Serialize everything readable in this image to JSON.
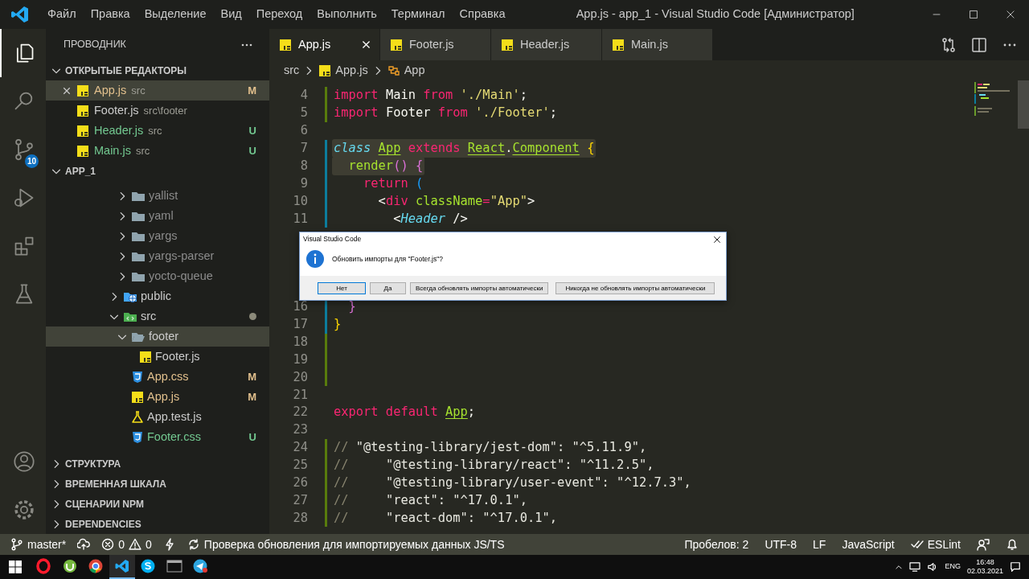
{
  "title_bar": {
    "menu": [
      "Файл",
      "Правка",
      "Выделение",
      "Вид",
      "Переход",
      "Выполнить",
      "Терминал",
      "Справка"
    ],
    "title": "App.js - app_1 - Visual Studio Code [Администратор]"
  },
  "activity_bar": [
    {
      "kind": "explorer",
      "selected": true
    },
    {
      "kind": "search",
      "selected": false
    },
    {
      "kind": "source-control",
      "selected": false,
      "badge": "10"
    },
    {
      "kind": "run",
      "selected": false
    },
    {
      "kind": "extensions",
      "selected": false
    },
    {
      "kind": "testing",
      "selected": false
    }
  ],
  "activity_bar_bottom": [
    {
      "kind": "account"
    },
    {
      "kind": "settings"
    }
  ],
  "sidebar": {
    "title": "ПРОВОДНИК",
    "open_editors": {
      "title": "ОТКРЫТЫЕ РЕДАКТОРЫ",
      "expanded": true,
      "items": [
        {
          "name": "App.js",
          "description": "src",
          "kind": "js",
          "modified": true,
          "badge": "M",
          "selected": true
        },
        {
          "name": "Footer.js",
          "description": "src\\footer",
          "kind": "js",
          "selected": false
        },
        {
          "name": "Header.js",
          "description": "src",
          "kind": "js",
          "untracked": true,
          "badge": "U",
          "selected": false
        },
        {
          "name": "Main.js",
          "description": "src",
          "kind": "js",
          "untracked": true,
          "badge": "U",
          "selected": false
        }
      ]
    },
    "project": {
      "title": "APP_1",
      "expanded": true,
      "tree": [
        {
          "children": [
            {
              "label": "yallist",
              "kind": "folder",
              "expanded": false,
              "ignored": true,
              "selected": false
            },
            {
              "label": "yaml",
              "kind": "folder",
              "expanded": false,
              "ignored": true,
              "selected": false
            },
            {
              "label": "yargs",
              "kind": "folder",
              "expanded": false,
              "ignored": true,
              "selected": false
            },
            {
              "label": "yargs-parser",
              "kind": "folder",
              "expanded": false,
              "ignored": true,
              "selected": false
            },
            {
              "label": "yocto-queue",
              "kind": "folder",
              "expanded": false,
              "ignored": true,
              "selected": false
            }
          ]
        },
        {
          "label": "public",
          "kind": "public-folder",
          "expanded": false,
          "selected": false
        },
        {
          "label": "src",
          "kind": "src-folder",
          "expanded": true,
          "dot": true,
          "selected": false,
          "children": [
            {
              "label": "footer",
              "kind": "folder",
              "expanded": true,
              "selected": true,
              "children": [
                {
                  "label": "Footer.js",
                  "kind": "js",
                  "selected": false
                }
              ]
            },
            {
              "label": "App.css",
              "kind": "css",
              "modified": true,
              "badge": "M",
              "selected": false
            },
            {
              "label": "App.js",
              "kind": "js",
              "modified": true,
              "badge": "M",
              "selected": false
            },
            {
              "label": "App.test.js",
              "kind": "test",
              "selected": false
            },
            {
              "label": "Footer.css",
              "kind": "css",
              "untracked": true,
              "badge": "U",
              "selected": false
            }
          ]
        }
      ]
    },
    "sections": [
      {
        "title": "СТРУКТУРА",
        "expanded": false
      },
      {
        "title": "ВРЕМЕННАЯ ШКАЛА",
        "expanded": false
      },
      {
        "title": "СЦЕНАРИИ NPM",
        "expanded": false
      },
      {
        "title": "DEPENDENCIES",
        "expanded": false
      }
    ]
  },
  "tabs": [
    {
      "name": "App.js",
      "kind": "js",
      "selected": true
    },
    {
      "name": "Footer.js",
      "kind": "js",
      "selected": false
    },
    {
      "name": "Header.js",
      "kind": "js",
      "selected": false
    },
    {
      "name": "Main.js",
      "kind": "js",
      "selected": false
    }
  ],
  "editor_actions": [
    {
      "kind": "compare"
    },
    {
      "kind": "split"
    },
    {
      "kind": "more"
    }
  ],
  "breadcrumb": [
    {
      "label": "src",
      "kind": "folder"
    },
    {
      "label": "App.js",
      "kind": "js"
    },
    {
      "label": "App",
      "kind": "class"
    }
  ],
  "code": [
    {
      "lines": [
        {
          "n": "4",
          "added": true,
          "tokens": [
            {
              "t": "import",
              "kind": "kw"
            },
            {
              "t": " Main ",
              "kind": "plain"
            },
            {
              "t": "from",
              "kind": "kw"
            },
            {
              "t": " './Main'",
              "kind": "str"
            },
            {
              "t": ";",
              "kind": "plain"
            }
          ]
        },
        {
          "n": "5",
          "added": true,
          "tokens": [
            {
              "t": "import",
              "kind": "kw"
            },
            {
              "t": " Footer ",
              "kind": "plain"
            },
            {
              "t": "from",
              "kind": "kw"
            },
            {
              "t": " './Footer'",
              "kind": "str"
            },
            {
              "t": ";",
              "kind": "plain"
            }
          ]
        },
        {
          "n": "6"
        },
        {
          "n": "7",
          "modified": true,
          "highlight": true,
          "tokens": [
            {
              "t": "class ",
              "kind": "storage"
            },
            {
              "t": "App",
              "kind": "cls"
            },
            {
              "t": " extends ",
              "kind": "kw"
            },
            {
              "t": "React",
              "kind": "cls"
            },
            {
              "t": ".",
              "kind": "plain"
            },
            {
              "t": "Component",
              "kind": "cls"
            },
            {
              "t": " {",
              "kind": "b1"
            }
          ]
        },
        {
          "n": "8",
          "modified": true,
          "highlight": true,
          "tokens": [
            {
              "t": "  render",
              "kind": "fn"
            },
            {
              "t": "() {",
              "kind": "b2"
            }
          ]
        },
        {
          "n": "9",
          "modified": true,
          "tokens": [
            {
              "t": "    return",
              "kind": "kw"
            },
            {
              "t": " (",
              "kind": "b3"
            }
          ]
        },
        {
          "n": "10",
          "modified": true,
          "tokens": [
            {
              "t": "      <",
              "kind": "plain"
            },
            {
              "t": "div",
              "kind": "kw"
            },
            {
              "t": " className",
              "kind": "fn"
            },
            {
              "t": "=",
              "kind": "kw"
            },
            {
              "t": "\"App\"",
              "kind": "str"
            },
            {
              "t": ">",
              "kind": "plain"
            }
          ]
        },
        {
          "n": "11",
          "modified": true,
          "tokens": [
            {
              "t": "        <",
              "kind": "plain"
            },
            {
              "t": "Header",
              "kind": "comp"
            },
            {
              "t": " />",
              "kind": "plain"
            }
          ]
        }
      ]
    },
    {
      "lines": [
        {
          "n": "16",
          "modified": true,
          "tokens": [
            {
              "t": "  }",
              "kind": "b2"
            }
          ]
        },
        {
          "n": "17",
          "modified": true,
          "tokens": [
            {
              "t": "}",
              "kind": "b1"
            }
          ]
        },
        {
          "n": "18",
          "added": true
        },
        {
          "n": "19",
          "added": true
        },
        {
          "n": "20",
          "added": true
        },
        {
          "n": "21"
        },
        {
          "n": "22",
          "tokens": [
            {
              "t": "export default ",
              "kind": "kw"
            },
            {
              "t": "App",
              "kind": "cls"
            },
            {
              "t": ";",
              "kind": "plain"
            }
          ]
        },
        {
          "n": "23"
        },
        {
          "n": "24",
          "added": true,
          "tokens": [
            {
              "t": "//",
              "kind": "comment"
            },
            {
              "t": " \"@testing-library/jest-dom\": \"^5.11.9\",",
              "kind": "ctext"
            }
          ]
        },
        {
          "n": "25",
          "added": true,
          "tokens": [
            {
              "t": "//",
              "kind": "comment"
            },
            {
              "t": "     \"@testing-library/react\": \"^11.2.5\",",
              "kind": "ctext"
            }
          ]
        },
        {
          "n": "26",
          "added": true,
          "tokens": [
            {
              "t": "//",
              "kind": "comment"
            },
            {
              "t": "     \"@testing-library/user-event\": \"^12.7.3\",",
              "kind": "ctext"
            }
          ]
        },
        {
          "n": "27",
          "added": true,
          "tokens": [
            {
              "t": "//",
              "kind": "comment"
            },
            {
              "t": "     \"react\": \"^17.0.1\",",
              "kind": "ctext"
            }
          ]
        },
        {
          "n": "28",
          "added": true,
          "tokens": [
            {
              "t": "//",
              "kind": "comment"
            },
            {
              "t": "     \"react-dom\": \"^17.0.1\",",
              "kind": "ctext"
            }
          ]
        }
      ]
    }
  ],
  "dialog": {
    "title": "Visual Studio Code",
    "message": "Обновить импорты для \"Footer.js\"?",
    "buttons": [
      {
        "label": "Нет",
        "focused": true
      },
      {
        "label": "Да",
        "focused": false
      },
      {
        "label": "Всегда обновлять импорты автоматически",
        "focused": false
      },
      {
        "label": "Никогда не обновлять импорты автоматически",
        "focused": false
      }
    ]
  },
  "status_bar": {
    "left": [
      {
        "kind": "branch",
        "text": "master*"
      },
      {
        "kind": "publish"
      },
      {
        "kind": "problems",
        "errors": "0",
        "warnings": "0"
      },
      {
        "kind": "lightning"
      },
      {
        "kind": "sync",
        "text": "Проверка обновления для импортируемых данных JS/TS"
      }
    ],
    "right": [
      {
        "kind": "text",
        "text": "Пробелов: 2"
      },
      {
        "kind": "text",
        "text": "UTF-8"
      },
      {
        "kind": "text",
        "text": "LF"
      },
      {
        "kind": "text",
        "text": "JavaScript"
      },
      {
        "kind": "check",
        "text": "ESLint"
      },
      {
        "kind": "feedback"
      },
      {
        "kind": "bell"
      }
    ]
  },
  "taskbar": {
    "apps": [
      {
        "kind": "opera",
        "selected": false
      },
      {
        "kind": "torrent",
        "selected": false
      },
      {
        "kind": "chrome",
        "selected": false
      },
      {
        "kind": "vscode",
        "selected": true
      },
      {
        "kind": "skype",
        "selected": false
      },
      {
        "kind": "terminal",
        "selected": false
      },
      {
        "kind": "telegram",
        "selected": false
      }
    ],
    "language": "ENG",
    "time": "16:48",
    "date": "02.03.2021"
  }
}
